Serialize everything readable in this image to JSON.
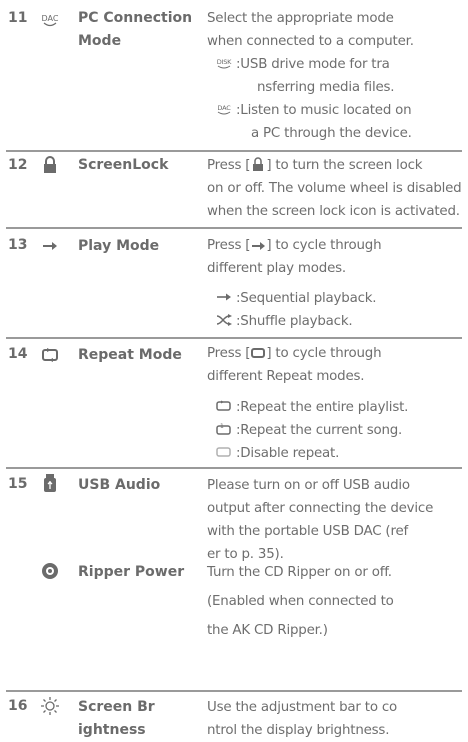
{
  "rows": [
    {
      "number": "11",
      "icon": "dac-icon",
      "name": [
        "PC Connection",
        "Mode"
      ],
      "desc": [
        "Select the appropriate mode",
        "when connected to a computer."
      ],
      "subs": [
        {
          "icon": "disk-icon",
          "lines": [
            ":USB drive mode for  tra",
            "nsferring media files."
          ]
        },
        {
          "icon": "dac-icon",
          "lines": [
            ":Listen to music located on",
            "a PC through the device."
          ]
        }
      ]
    },
    {
      "number": "12",
      "icon": "lock-icon",
      "name": [
        "ScreenLock"
      ],
      "desc_pre": "Press [",
      "desc_post": "] to turn the screen lock",
      "desc": [
        "on or off. The volume wheel is disabled",
        "when the screen lock icon is activated."
      ]
    },
    {
      "number": "13",
      "icon": "arrow-right-icon",
      "name": [
        "Play Mode"
      ],
      "desc_pre": "Press [",
      "desc_post": "] to cycle through",
      "desc": [
        "different play modes."
      ],
      "subs": [
        {
          "icon": "sequential-icon",
          "lines": [
            ":Sequential playback."
          ]
        },
        {
          "icon": "shuffle-icon",
          "lines": [
            ":Shuffle playback."
          ]
        }
      ]
    },
    {
      "number": "14",
      "icon": "repeat-icon",
      "name": [
        "Repeat Mode"
      ],
      "desc_pre": "Press [",
      "desc_post": "] to cycle through",
      "desc": [
        "different Repeat modes."
      ],
      "subs": [
        {
          "icon": "repeat-all-icon",
          "lines": [
            ":Repeat the entire playlist."
          ]
        },
        {
          "icon": "repeat-one-icon",
          "lines": [
            ":Repeat the current song."
          ]
        },
        {
          "icon": "repeat-off-icon",
          "lines": [
            ":Disable repeat."
          ]
        }
      ]
    },
    {
      "number": "15",
      "icon": "usb-audio-icon",
      "name": [
        "USB Audio"
      ],
      "desc": [
        "Please turn on or off USB audio",
        "output after connecting the device",
        "with the portable USB DAC (ref",
        "er to p. 35)."
      ]
    },
    {
      "icon": "disc-icon",
      "name": [
        "Ripper Power"
      ],
      "desc": [
        "Turn the CD Ripper on or off.",
        "(Enabled when connected to",
        "the AK CD Ripper.)"
      ]
    },
    {
      "number": "16",
      "icon": "brightness-icon",
      "name": [
        "Screen Br",
        "ightness"
      ],
      "desc": [
        "Use the adjustment bar to co",
        "ntrol the display brightness."
      ]
    }
  ]
}
